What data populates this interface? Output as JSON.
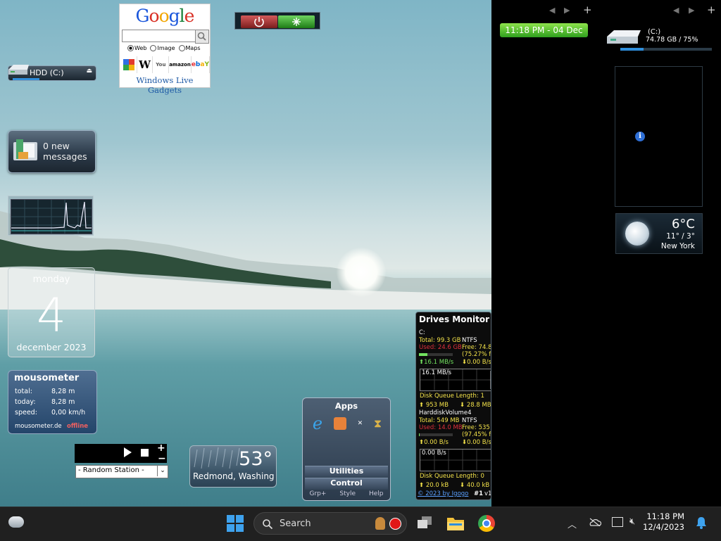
{
  "colors": {
    "sidebar_bg": "#000000",
    "taskbar_bg": "#202020",
    "clock_green": "#5cc43a",
    "accent_blue": "#2f8edb"
  },
  "google": {
    "logo_letters": [
      "G",
      "o",
      "o",
      "g",
      "l",
      "e"
    ],
    "radios": [
      "Web",
      "Image",
      "Maps"
    ],
    "sites": [
      "wikipedia",
      "youtube",
      "amazon",
      "ebay"
    ],
    "footer": "Windows Live Gadgets"
  },
  "hdd_left": {
    "label": "HDD (C:)",
    "icon": "hard-drive-icon",
    "eject_icon": "eject-icon"
  },
  "mail": {
    "line1": "0 new",
    "line2": "messages",
    "icon": "mail-icon"
  },
  "calendar": {
    "weekday": "monday",
    "day": "4",
    "month_year": "december 2023"
  },
  "mousometer": {
    "title": "mousometer",
    "rows": [
      {
        "label": "total:",
        "value": "8,28 m"
      },
      {
        "label": "today:",
        "value": "8,28 m"
      },
      {
        "label": "speed:",
        "value": "0,00 km/h"
      }
    ],
    "site": "mousometer.de",
    "status": "offline"
  },
  "radio": {
    "station": "- Random Station -"
  },
  "weather_bottom": {
    "temp": "53°",
    "city": "Redmond, Washing"
  },
  "apps_gadget": {
    "title": "Apps",
    "buttons": [
      "Utilities",
      "Control"
    ],
    "footer": [
      "Grp+",
      "Style",
      "Help"
    ]
  },
  "drives_monitor": {
    "title": "Drives Monitor",
    "drive1": {
      "name": "C:",
      "total": "Total: 99.3 GB",
      "fs": "NTFS",
      "used": "Used: 24.6 GB",
      "free": "Free: 74.8 G",
      "free_pct": "(75.27% fre",
      "read": "16.1 MB/s",
      "write": "0.00 B/s",
      "chart_label": "16.1 MB/s",
      "queue": "Disk Queue Length: 1",
      "r_total": "953 MB",
      "w_total": "28.8 MB"
    },
    "drive2": {
      "name": "HarddiskVolume4",
      "total": "Total: 549 MB",
      "fs": "NTFS",
      "used": "Used: 14.0 MB",
      "free": "Free: 535 N",
      "free_pct": "(97.45% fre",
      "read": "0.00 B/s",
      "write": "0.00 B/s",
      "chart_label": "0.00 B/s",
      "queue": "Disk Queue Length: 0",
      "r_total": "20.0 kB",
      "w_total": "40.0 kB"
    },
    "footer_link": "© 2023 by Igogo",
    "footer_tag": "#1",
    "footer_ver": "v1"
  },
  "sidebar": {
    "clock": "11:18 PM - 04 Dec",
    "hdd_label": "(C:)",
    "hdd_value": "74.78 GB / 75%",
    "hdd_used_fraction": 0.25,
    "weather_temp": "6°C",
    "weather_hilo": "11° / 3°",
    "weather_city": "New York"
  },
  "taskbar": {
    "search_placeholder": "Search",
    "time": "11:18 PM",
    "date": "12/4/2023"
  }
}
